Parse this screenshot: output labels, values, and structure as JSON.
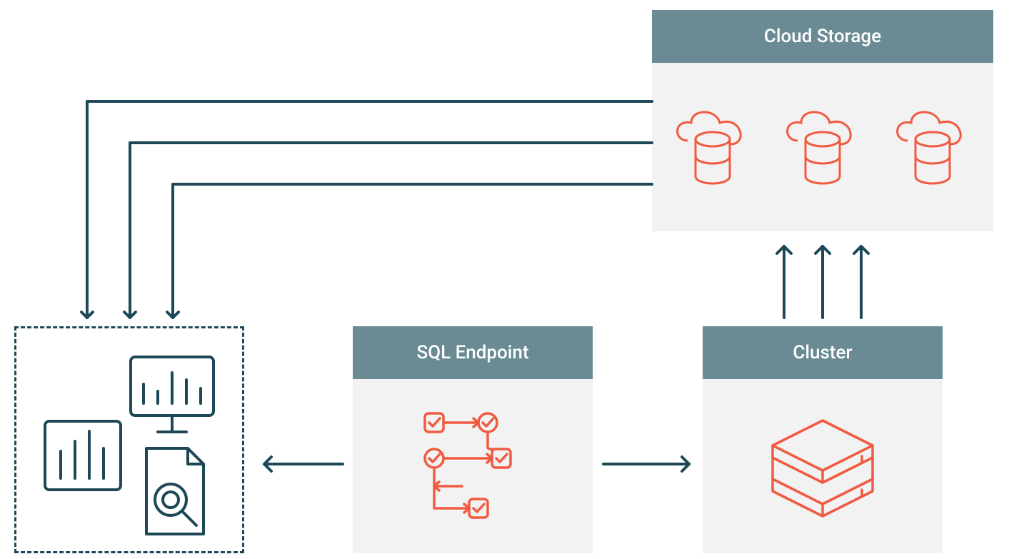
{
  "boxes": {
    "cloud_storage": {
      "label": "Cloud Storage"
    },
    "sql_endpoint": {
      "label": "SQL Endpoint"
    },
    "cluster": {
      "label": "Cluster"
    }
  },
  "colors": {
    "header_bg": "#6a8b94",
    "header_text": "#ffffff",
    "box_body_bg": "#f2f2f2",
    "accent_orange": "#f15a40",
    "line_navy": "#1d4858",
    "dashed_navy": "#1d4858"
  }
}
